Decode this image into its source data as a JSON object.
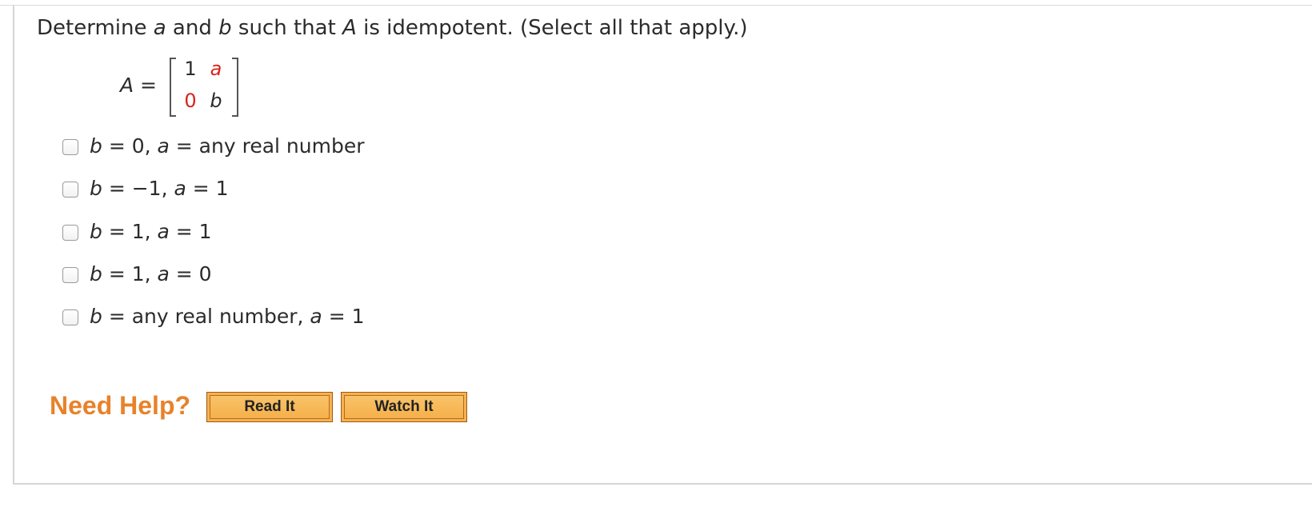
{
  "question": {
    "prefix": "Determine ",
    "var_a": "a",
    "and": " and ",
    "var_b": "b",
    "middle": " such that ",
    "var_A": "A",
    "suffix": " is idempotent. (Select all that apply.)"
  },
  "matrix": {
    "name": "A",
    "equals": " =",
    "cells": [
      [
        "1",
        "a"
      ],
      [
        "0",
        "b"
      ]
    ]
  },
  "options": [
    {
      "b_var": "b",
      "b_part": " = 0, ",
      "a_var": "a",
      "a_part": " = any real number"
    },
    {
      "b_var": "b",
      "b_part": " = −1, ",
      "a_var": "a",
      "a_part": " = 1"
    },
    {
      "b_var": "b",
      "b_part": " = 1, ",
      "a_var": "a",
      "a_part": " = 1"
    },
    {
      "b_var": "b",
      "b_part": " = 1, ",
      "a_var": "a",
      "a_part": " = 0"
    },
    {
      "b_var": "b",
      "b_part": " = any real number, ",
      "a_var": "a",
      "a_part": " = 1"
    }
  ],
  "help": {
    "label": "Need Help?",
    "read_it": "Read It",
    "watch_it": "Watch It"
  },
  "colors": {
    "highlight": "#d8231c",
    "need_help": "#e7822a",
    "button": "#f7b24d"
  }
}
